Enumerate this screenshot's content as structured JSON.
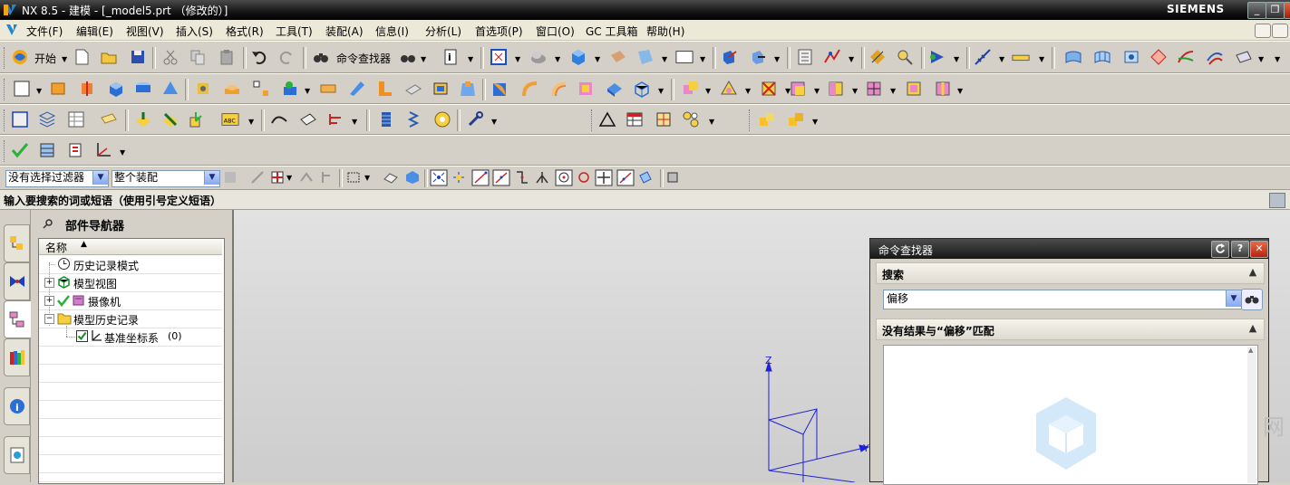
{
  "window": {
    "title": "NX 8.5 - 建模 - [_model5.prt （修改的）]",
    "brand": "SIEMENS",
    "controls": [
      "_",
      "❐",
      "✕"
    ]
  },
  "menubar": {
    "items": [
      "文件(F)",
      "编辑(E)",
      "视图(V)",
      "插入(S)",
      "格式(R)",
      "工具(T)",
      "装配(A)",
      "信息(I)",
      "分析(L)",
      "首选项(P)",
      "窗口(O)",
      "GC 工具箱",
      "帮助(H)"
    ]
  },
  "toolbar": {
    "start_label": "开始",
    "command_finder_label": "命令查找器"
  },
  "selection_bar": {
    "filter_value": "没有选择过滤器",
    "scope_value": "整个装配"
  },
  "cue_line": {
    "text": "输入要搜索的词或短语（使用引号定义短语）"
  },
  "resource_bar": {
    "tabs": [
      "assembly-navigator",
      "constraint-navigator",
      "part-navigator",
      "reuse-library",
      "history",
      "web-browser"
    ]
  },
  "part_navigator": {
    "title": "部件导航器",
    "column_header": "名称",
    "rows": [
      {
        "label": "历史记录模式"
      },
      {
        "label": "模型视图"
      },
      {
        "label": "摄像机"
      },
      {
        "label": "模型历史记录"
      },
      {
        "label": "基准坐标系",
        "suffix": "(0)"
      }
    ]
  },
  "viewport": {
    "axis_labels": {
      "z": "Z",
      "y": "Y"
    }
  },
  "command_finder": {
    "title": "命令查找器",
    "search_group_label": "搜索",
    "search_value": "偏移",
    "results_group_label": "没有结果与“偏移”匹配"
  },
  "colors": {
    "title_bar": "#1a1a1a",
    "axis_blue": "#1f22d8",
    "combo_arrow": "#86a8f0"
  }
}
